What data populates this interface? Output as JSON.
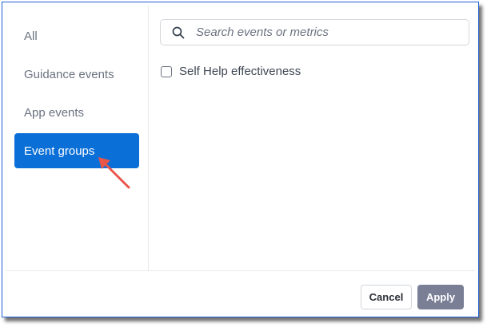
{
  "sidebar": {
    "items": [
      {
        "label": "All"
      },
      {
        "label": "Guidance events"
      },
      {
        "label": "App events"
      },
      {
        "label": "Event groups",
        "active": true
      }
    ]
  },
  "search": {
    "placeholder": "Search events or metrics",
    "value": ""
  },
  "options": [
    {
      "label": "Self Help effectiveness",
      "checked": false
    }
  ],
  "footer": {
    "cancel_label": "Cancel",
    "apply_label": "Apply"
  },
  "colors": {
    "accent": "#0b6fd8",
    "apply_button": "#7a7f96",
    "annotation_arrow": "#e8564a",
    "frame_border": "#1e5fd8"
  }
}
